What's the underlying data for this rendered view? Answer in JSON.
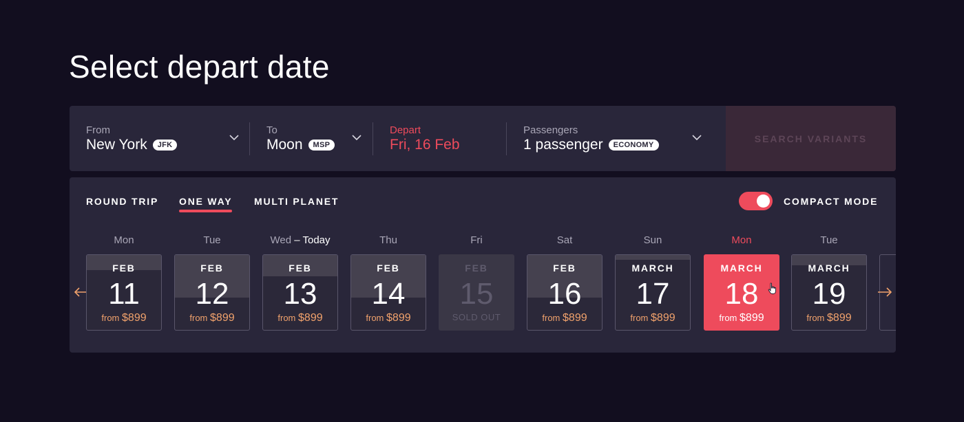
{
  "page_title": "Select depart date",
  "search": {
    "from": {
      "label": "From",
      "city": "New York",
      "code": "JFK"
    },
    "to": {
      "label": "To",
      "city": "Moon",
      "code": "MSP"
    },
    "depart": {
      "label": "Depart",
      "value": "Fri, 16 Feb"
    },
    "passengers": {
      "label": "Passengers",
      "value": "1 passenger",
      "class": "ECONOMY"
    },
    "button_label": "SEARCH VARIANTS"
  },
  "trip_tabs": [
    {
      "label": "ROUND TRIP",
      "active": false
    },
    {
      "label": "ONE WAY",
      "active": true
    },
    {
      "label": "MULTI PLANET",
      "active": false
    }
  ],
  "compact_mode": {
    "label": "COMPACT MODE",
    "enabled": true
  },
  "days": [
    {
      "weekday": "Mon",
      "month": "FEB",
      "day": "11",
      "from": "from",
      "price": "$899",
      "status": "available",
      "fill": 0.2
    },
    {
      "weekday": "Tue",
      "month": "FEB",
      "day": "12",
      "from": "from",
      "price": "$899",
      "status": "available",
      "fill": 0.57
    },
    {
      "weekday": "Wed",
      "weekday_suffix": "– Today",
      "month": "FEB",
      "day": "13",
      "from": "from",
      "price": "$899",
      "status": "available",
      "fill": 0.28
    },
    {
      "weekday": "Thu",
      "month": "FEB",
      "day": "14",
      "from": "from",
      "price": "$899",
      "status": "available",
      "fill": 0.57
    },
    {
      "weekday": "Fri",
      "month": "FEB",
      "day": "15",
      "sold_label": "SOLD OUT",
      "status": "sold_out",
      "fill": 0
    },
    {
      "weekday": "Sat",
      "month": "FEB",
      "day": "16",
      "from": "from",
      "price": "$899",
      "status": "available",
      "fill": 0.57
    },
    {
      "weekday": "Sun",
      "month": "MARCH",
      "day": "17",
      "from": "from",
      "price": "$899",
      "status": "available",
      "fill": 0.06
    },
    {
      "weekday": "Mon",
      "month": "MARCH",
      "day": "18",
      "from": "from",
      "price": "$899",
      "status": "selected",
      "fill": 0
    },
    {
      "weekday": "Tue",
      "month": "MARCH",
      "day": "19",
      "from": "from",
      "price": "$899",
      "status": "available",
      "fill": 0.14
    }
  ],
  "colors": {
    "accent": "#ee4b5c",
    "price": "#f1a26c",
    "background": "#120e1f",
    "panel": "#29263a"
  },
  "icons": {
    "prev": "arrow-left-icon",
    "next": "arrow-right-icon",
    "dropdown": "chevron-down-icon",
    "cursor": "hand-pointer-icon"
  }
}
